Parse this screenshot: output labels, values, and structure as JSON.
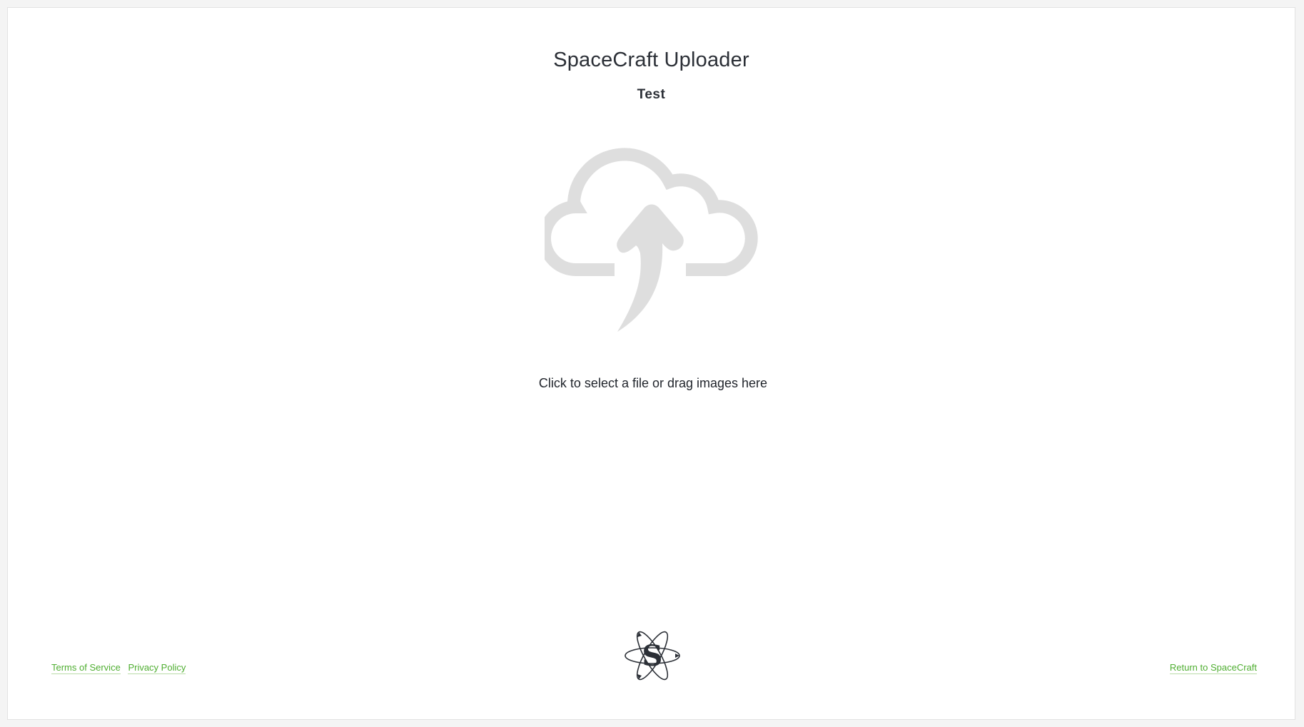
{
  "header": {
    "title": "SpaceCraft Uploader",
    "subtitle": "Test"
  },
  "dropzone": {
    "icon": "cloud-upload-icon",
    "instruction": "Click to select a file or drag images here"
  },
  "footer": {
    "links_left": [
      {
        "label": "Terms of Service"
      },
      {
        "label": "Privacy Policy"
      }
    ],
    "return_link": "Return to SpaceCraft",
    "logo_icon": "spacecraft-atom-logo-icon"
  },
  "colors": {
    "link": "#4fae31",
    "icon": "#dedede",
    "text": "#2b2f36"
  }
}
